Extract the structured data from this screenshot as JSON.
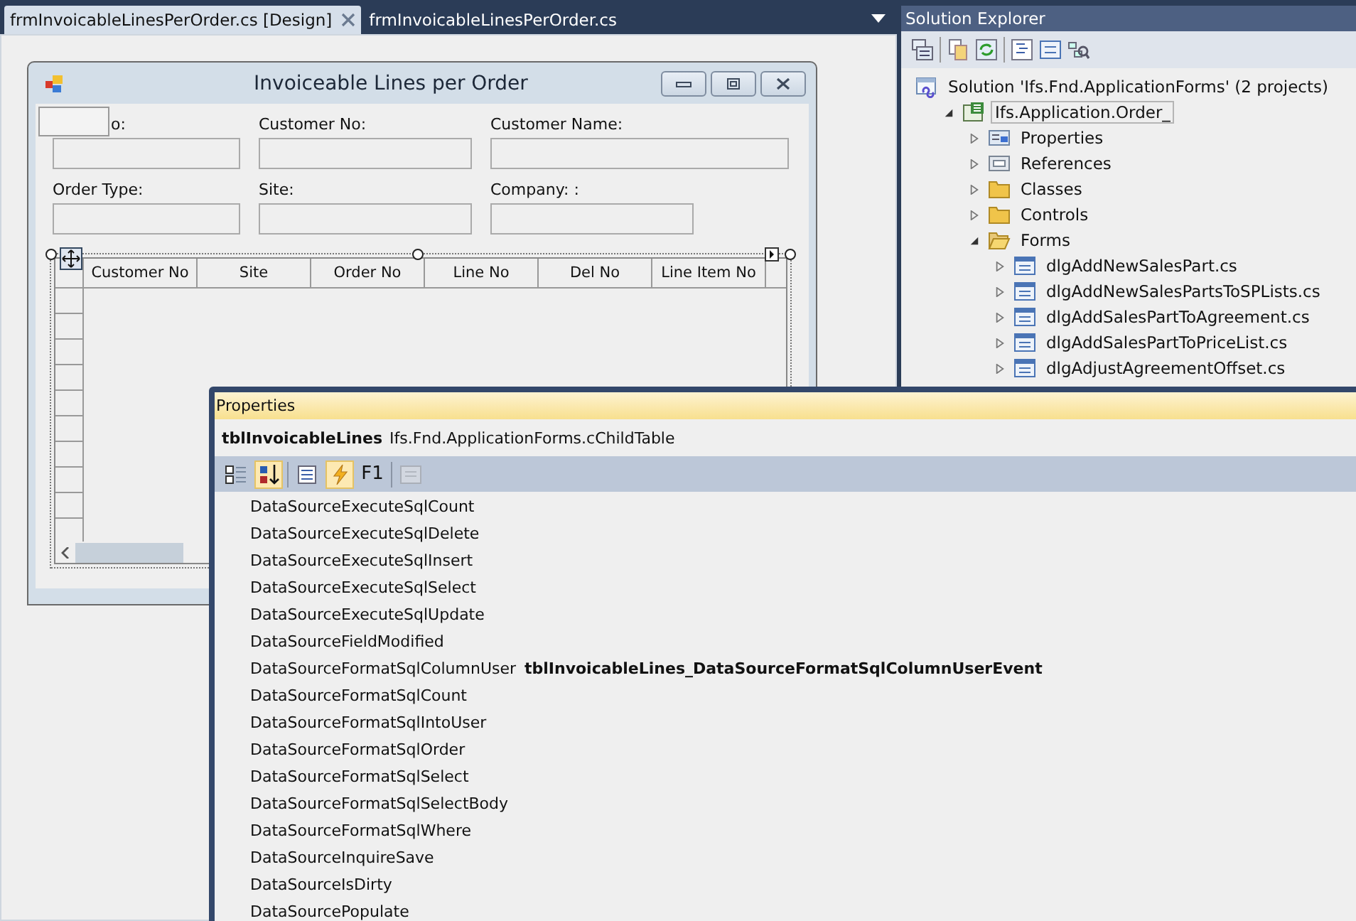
{
  "document_tabs": [
    {
      "label": "frmInvoicableLinesPerOrder.cs [Design]",
      "selected": true,
      "closable": true
    },
    {
      "label": "frmInvoicableLinesPerOrder.cs",
      "selected": false,
      "closable": false
    }
  ],
  "form": {
    "title": "Invoiceable Lines per Order",
    "fields": [
      {
        "label": "o:"
      },
      {
        "label": "Customer No:"
      },
      {
        "label": "Customer Name:"
      },
      {
        "label": "Order Type:"
      },
      {
        "label": "Site:"
      },
      {
        "label": "Company: :"
      }
    ],
    "table": {
      "columns": [
        "Customer No",
        "Site",
        "Order No",
        "Line No",
        "Del No",
        "Line Item No"
      ]
    }
  },
  "solution_explorer": {
    "title": "Solution Explorer",
    "tree": [
      {
        "label": "Solution 'Ifs.Fnd.ApplicationForms' (2 projects)",
        "kind": "solution",
        "selected": false,
        "children": [
          {
            "label": "Ifs.Application.Order_",
            "kind": "project",
            "expanded": true,
            "selected": true,
            "children": [
              {
                "label": "Properties",
                "kind": "properties",
                "expanded": false,
                "selected": false
              },
              {
                "label": "References",
                "kind": "references",
                "expanded": false,
                "selected": false
              },
              {
                "label": "Classes",
                "kind": "folder",
                "expanded": false,
                "selected": false
              },
              {
                "label": "Controls",
                "kind": "folder",
                "expanded": false,
                "selected": false
              },
              {
                "label": "Forms",
                "kind": "folder",
                "expanded": true,
                "selected": false,
                "children": [
                  {
                    "label": "dlgAddNewSalesPart.cs",
                    "kind": "form",
                    "expanded": false,
                    "selected": false
                  },
                  {
                    "label": "dlgAddNewSalesPartsToSPLists.cs",
                    "kind": "form",
                    "expanded": false,
                    "selected": false
                  },
                  {
                    "label": "dlgAddSalesPartToAgreement.cs",
                    "kind": "form",
                    "expanded": false,
                    "selected": false
                  },
                  {
                    "label": "dlgAddSalesPartToPriceList.cs",
                    "kind": "form",
                    "expanded": false,
                    "selected": false
                  },
                  {
                    "label": "dlgAdjustAgreementOffset.cs",
                    "kind": "form",
                    "expanded": false,
                    "selected": false
                  }
                ]
              }
            ]
          }
        ]
      }
    ]
  },
  "properties": {
    "title": "Properties",
    "object_name": "tblInvoicableLines",
    "object_type": "Ifs.Fnd.ApplicationForms.cChildTable",
    "toolbar": [
      {
        "kind": "categorized",
        "selected": false,
        "disabled": false
      },
      {
        "kind": "alphabetical",
        "selected": true,
        "disabled": false
      },
      {
        "kind": "separator"
      },
      {
        "kind": "properties",
        "selected": false,
        "disabled": false
      },
      {
        "kind": "events",
        "selected": true,
        "disabled": false
      },
      {
        "kind": "text",
        "label": "F1",
        "selected": false,
        "disabled": false
      },
      {
        "kind": "separator"
      },
      {
        "kind": "pages",
        "selected": false,
        "disabled": true
      }
    ],
    "rows": [
      {
        "name": "DataSourceExecuteSqlCount"
      },
      {
        "name": "DataSourceExecuteSqlDelete"
      },
      {
        "name": "DataSourceExecuteSqlInsert"
      },
      {
        "name": "DataSourceExecuteSqlSelect"
      },
      {
        "name": "DataSourceExecuteSqlUpdate"
      },
      {
        "name": "DataSourceFieldModified"
      },
      {
        "name": "DataSourceFormatSqlColumnUser",
        "value": "tblInvoicableLines_DataSourceFormatSqlColumnUserEvent"
      },
      {
        "name": "DataSourceFormatSqlCount"
      },
      {
        "name": "DataSourceFormatSqlIntoUser"
      },
      {
        "name": "DataSourceFormatSqlOrder"
      },
      {
        "name": "DataSourceFormatSqlSelect"
      },
      {
        "name": "DataSourceFormatSqlSelectBody"
      },
      {
        "name": "DataSourceFormatSqlWhere"
      },
      {
        "name": "DataSourceInquireSave"
      },
      {
        "name": "DataSourceIsDirty"
      },
      {
        "name": "DataSourcePopulate"
      }
    ]
  }
}
